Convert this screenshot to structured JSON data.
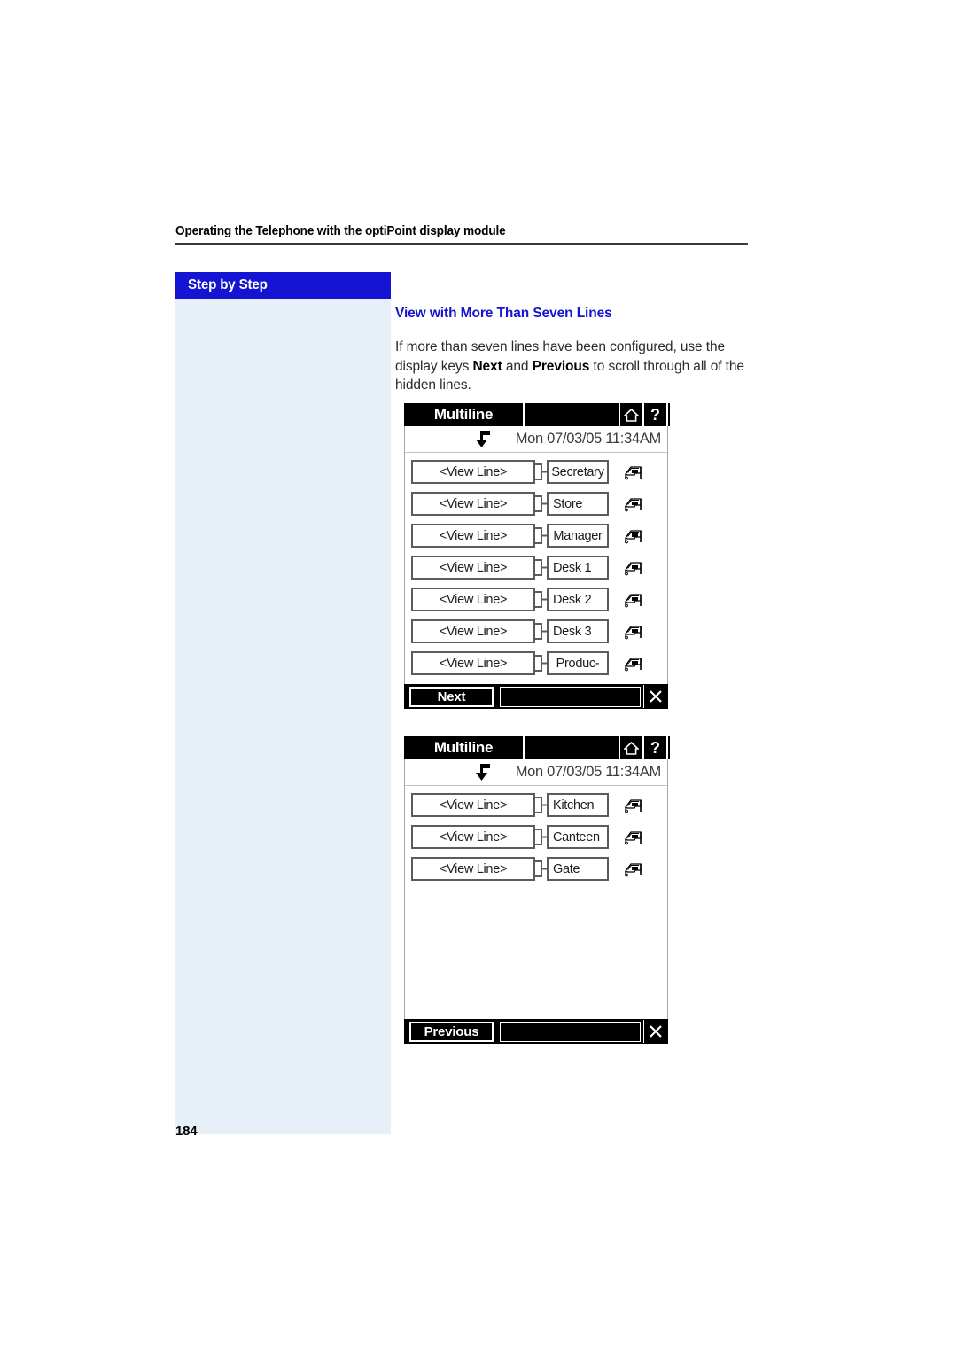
{
  "header": {
    "title": "Operating the Telephone with the optiPoint display module"
  },
  "sidebar": {
    "heading": "Step by Step"
  },
  "section": {
    "title": "View with More Than Seven Lines",
    "body_part1": "If more than seven lines have been configured, use the display keys ",
    "body_bold1": "Next",
    "body_part2": " and ",
    "body_bold2": "Previous",
    "body_part3": " to scroll through all of the hidden lines."
  },
  "colors": {
    "brand_blue": "#1414d2",
    "sidebar_fill": "#e7eff9",
    "text": "#2b2b2b"
  },
  "panels": [
    {
      "title": "Multiline",
      "home_icon": "home-icon",
      "help_label": "?",
      "datetime": "Mon 07/03/05 11:34AM",
      "hook_icon": "call-forward-arrow-icon",
      "view_line_label": "<View Line>",
      "rows": [
        {
          "view": "<View Line>",
          "name": "Secretary",
          "icon": "telephone-icon"
        },
        {
          "view": "<View Line>",
          "name": "Store",
          "icon": "telephone-icon"
        },
        {
          "view": "<View Line>",
          "name": "Manager",
          "icon": "telephone-icon"
        },
        {
          "view": "<View Line>",
          "name": "Desk 1",
          "icon": "telephone-icon"
        },
        {
          "view": "<View Line>",
          "name": "Desk 2",
          "icon": "telephone-icon"
        },
        {
          "view": "<View Line>",
          "name": "Desk 3",
          "icon": "telephone-icon"
        },
        {
          "view": "<View Line>",
          "name": "Produc-",
          "icon": "telephone-icon"
        }
      ],
      "softkey": "Next",
      "close_icon": "close-icon"
    },
    {
      "title": "Multiline",
      "home_icon": "home-icon",
      "help_label": "?",
      "datetime": "Mon 07/03/05 11:34AM",
      "hook_icon": "call-forward-arrow-icon",
      "view_line_label": "<View Line>",
      "rows": [
        {
          "view": "<View Line>",
          "name": "Kitchen",
          "icon": "telephone-icon"
        },
        {
          "view": "<View Line>",
          "name": "Canteen",
          "icon": "telephone-icon"
        },
        {
          "view": "<View Line>",
          "name": "Gate",
          "icon": "telephone-icon"
        }
      ],
      "softkey": "Previous",
      "close_icon": "close-icon"
    }
  ],
  "footer": {
    "page_number": "184"
  }
}
